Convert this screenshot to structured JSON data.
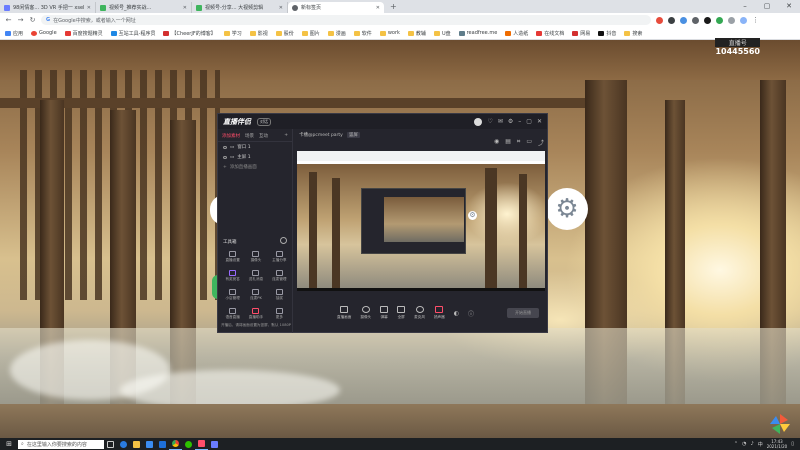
{
  "browser": {
    "tabs": [
      {
        "title": "98闲情客... 3D VR 手把一 xsel",
        "color": "#6a7cff",
        "active": false
      },
      {
        "title": "视频号_推荐实战...",
        "color": "#3fb55e",
        "active": false
      },
      {
        "title": "视频号-分享... 大视频剪辑",
        "color": "#3fb55e",
        "active": false
      },
      {
        "title": "新标签页",
        "color": "#5f6368",
        "active": true
      }
    ],
    "new_tab": "+",
    "omnibox_placeholder": "在Google中搜索，或者输入一个网址",
    "bookmarks": [
      "应用",
      "Google",
      "百度搜题精灵",
      "互站工具-程序员",
      "【CheerJF的博客】",
      "学习",
      "影视",
      "股份",
      "图片",
      "漫画",
      "软件",
      "work",
      "教辅",
      "U盘",
      "readfree.me",
      "人造纸",
      "在线文档",
      "网易",
      "抖音",
      "搜索"
    ]
  },
  "overlay": {
    "id_label": "直播号",
    "id_value": "10445560"
  },
  "app": {
    "logo": "直播伴侣",
    "version": "对话",
    "left_tabs": [
      "添加素材",
      "场景",
      "互动"
    ],
    "scenes": [
      "窗口 1",
      "主屏 1",
      "添加直播画面"
    ],
    "tools_heading": "工具箱",
    "tools": [
      "直播设置",
      "摄像头",
      "主播分享",
      "有奖竞答",
      "送礼消息",
      "连麦管理",
      "小店管理",
      "连麦PK",
      "抽奖",
      "语音直播",
      "直播助手",
      "更多"
    ],
    "tip": "开播后，请将画面设置为竖屏，默认 1080P",
    "preview_title": "卡槽@pcmeet party",
    "preview_chip": "竖屏",
    "controls": [
      "直播画面",
      "摄像头",
      "弹幕",
      "全屏",
      "麦克风",
      "扬声器"
    ],
    "go_live": "开始直播"
  },
  "taskbar": {
    "search_placeholder": "在这里输入你要搜索的内容",
    "time": "17:43",
    "date": "2021/1/20"
  },
  "colors": {
    "accent_pink": "#ff4e6a",
    "app_bg": "#25252d",
    "taskbar_bg": "#1d2023"
  }
}
